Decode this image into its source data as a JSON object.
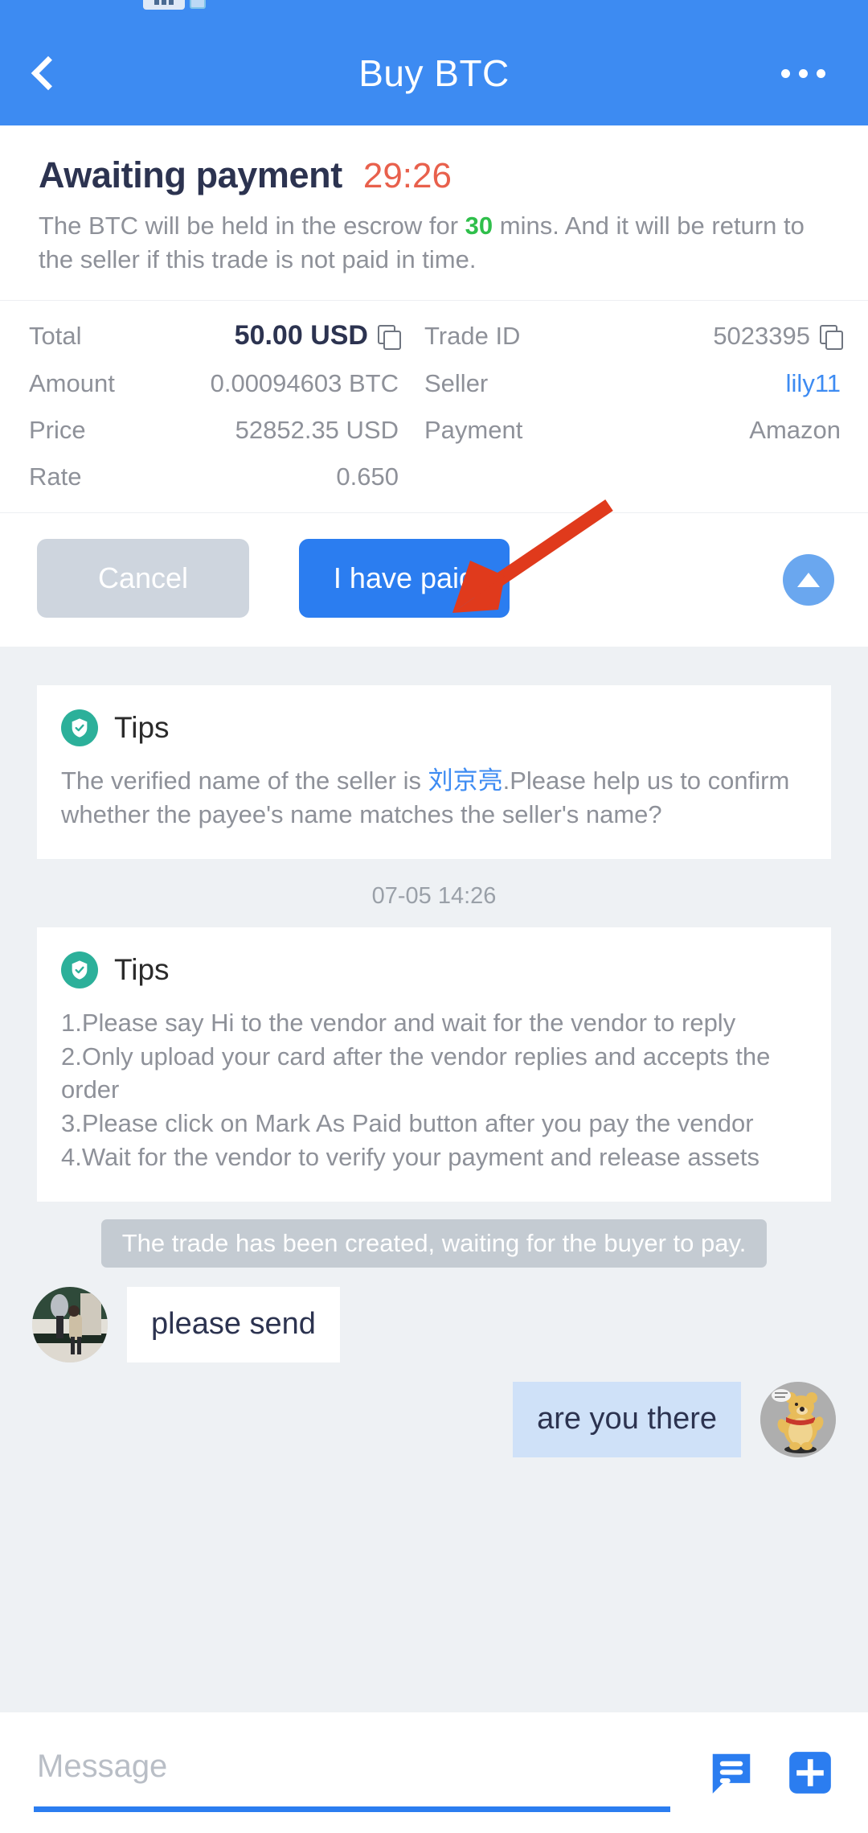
{
  "statusbar": {
    "visible": true
  },
  "appbar": {
    "title": "Buy BTC",
    "back_icon": "chevron-left-icon",
    "more_icon": "more-horizontal-icon"
  },
  "order": {
    "status_title": "Awaiting payment",
    "timer": "29:26",
    "desc_part1": "The BTC will be held in the escrow for ",
    "desc_highlight": "30",
    "desc_part2": " mins. And it will be return to the seller if this trade is not paid in time.",
    "fields": {
      "total_label": "Total",
      "total_value": "50.00 USD",
      "trade_id_label": "Trade ID",
      "trade_id_value": "5023395",
      "amount_label": "Amount",
      "amount_value": "0.00094603 BTC",
      "seller_label": "Seller",
      "seller_value": "lily11",
      "price_label": "Price",
      "price_value": "52852.35 USD",
      "payment_label": "Payment",
      "payment_value": "Amazon",
      "rate_label": "Rate",
      "rate_value": "0.650"
    }
  },
  "actions": {
    "cancel_label": "Cancel",
    "paid_label": "I have paid",
    "scroll_up_icon": "triangle-up-icon"
  },
  "tips_card_1": {
    "icon": "verified-shield-icon",
    "title": "Tips",
    "body_prefix": "The verified name of the seller is ",
    "body_name": "刘京亮",
    "body_suffix": ".Please help us to confirm whether the payee's name matches the seller's name?"
  },
  "timestamp": "07-05 14:26",
  "tips_card_2": {
    "icon": "verified-shield-icon",
    "title": "Tips",
    "lines": [
      "1.Please say Hi to the vendor and wait for the vendor to reply",
      "2.Only upload your card after the vendor replies and accepts the order",
      "3.Please click on Mark As Paid button after you pay the vendor",
      "4.Wait for the vendor to verify your payment and release assets"
    ]
  },
  "system_message": "The trade has been created, waiting for the buyer to pay.",
  "messages": [
    {
      "side": "incoming",
      "text": "please send",
      "avatar": "seller-photo-avatar"
    },
    {
      "side": "outgoing",
      "text": "are you there",
      "avatar": "pooh-figure-avatar"
    }
  ],
  "input": {
    "placeholder": "Message",
    "value": "",
    "quick_reply_icon": "chat-lines-icon",
    "add_icon": "plus-icon"
  },
  "colors": {
    "brand_blue": "#3d8bf2",
    "button_blue": "#2b7df0",
    "timer_red": "#e8604c",
    "highlight_green": "#2fbf4b",
    "link_blue": "#3d8bf2",
    "tip_teal": "#2cb09a",
    "outgoing_bubble": "#cfe1f8",
    "annotation_red": "#e03a1c"
  }
}
